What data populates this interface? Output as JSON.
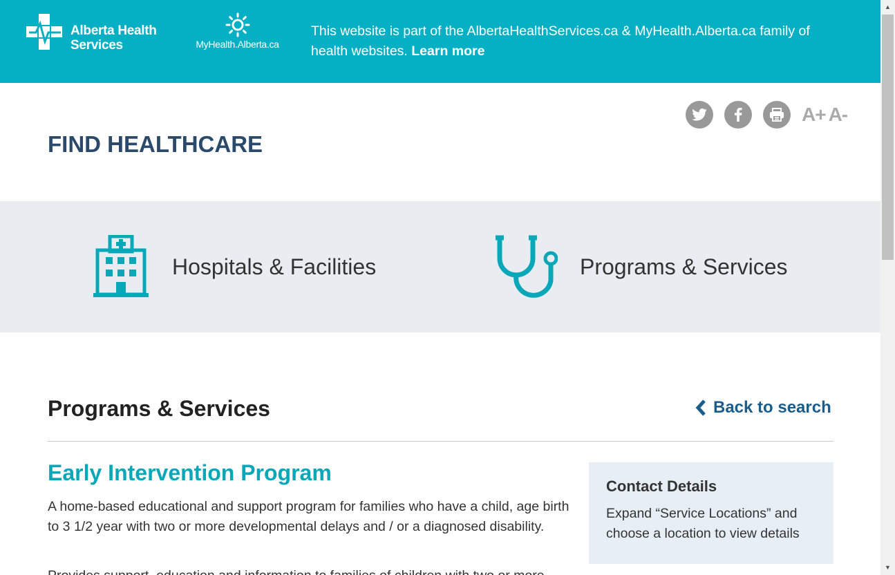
{
  "banner": {
    "ahs_logo_line1": "Alberta Health",
    "ahs_logo_line2": "Services",
    "myhealth_logo": "MyHealth.Alberta.ca",
    "message": "This website is part of the AlbertaHealthServices.ca & MyHealth.Alberta.ca family of health websites.",
    "learn_more": "Learn more",
    "bg_color": "#05b0c5"
  },
  "header": {
    "title": "FIND HEALTHCARE",
    "share_icons": [
      "twitter-icon",
      "facebook-icon",
      "print-icon"
    ],
    "font_increase": "A+",
    "font_decrease": "A-"
  },
  "categories": [
    {
      "label": "Hospitals & Facilities",
      "icon": "hospital-icon"
    },
    {
      "label": "Programs & Services",
      "icon": "stethoscope-icon"
    }
  ],
  "content": {
    "section_title": "Programs & Services",
    "back_link": "Back to search",
    "program_title": "Early Intervention Program",
    "program_description": "A home-based educational and support program for families who have a child, age birth to 3 1/2 year with two or more developmental delays and / or a diagnosed disability.",
    "program_description_2": "Provides support, education and information to families of children with two or more"
  },
  "contact": {
    "title": "Contact Details",
    "text": "Expand “Service Locations” and choose a location to view details"
  },
  "colors": {
    "accent_teal": "#05b0c5",
    "heading_navy": "#2b4a6b",
    "link_blue": "#1a5d8a"
  }
}
